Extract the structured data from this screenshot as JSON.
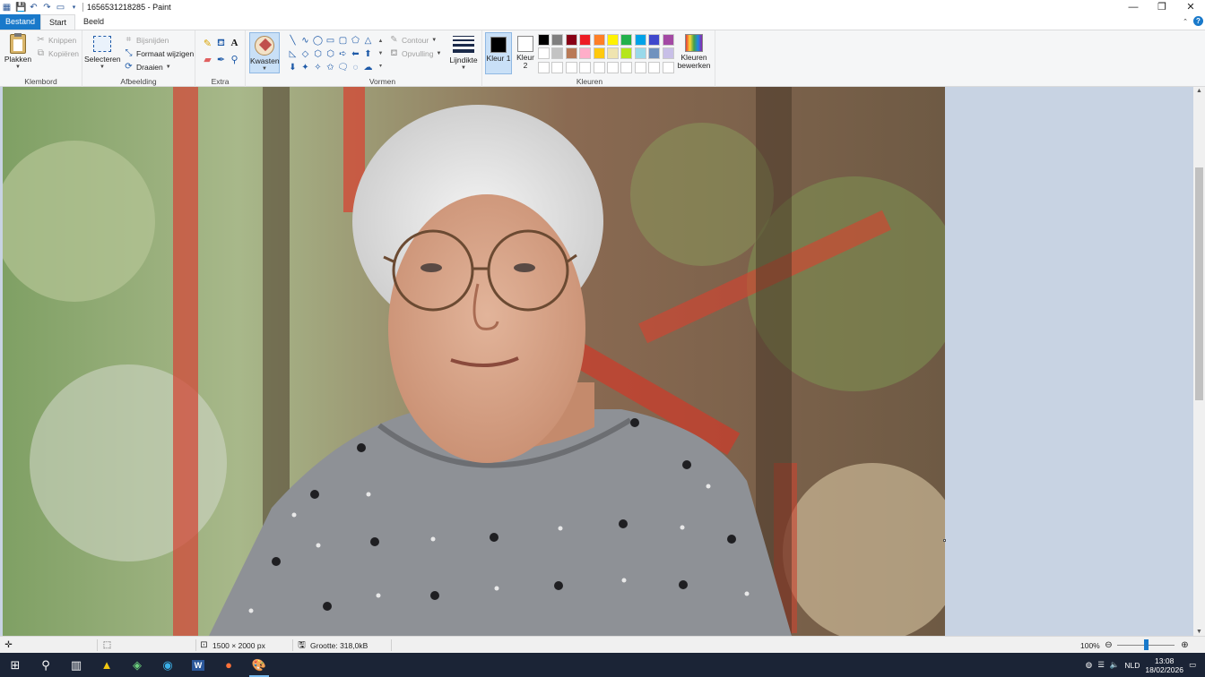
{
  "window": {
    "title": "1656531218285 - Paint",
    "controls": {
      "minimize": "—",
      "restore": "❐",
      "close": "✕"
    }
  },
  "quick_access": {
    "icons": [
      "paint-app-icon",
      "save-icon",
      "undo-icon",
      "redo-icon",
      "print-icon",
      "customize-dropdown-icon"
    ]
  },
  "tabs": [
    {
      "label": "Bestand"
    },
    {
      "label": "Start"
    },
    {
      "label": "Beeld"
    }
  ],
  "ribbon": {
    "klembord": {
      "label": "Klembord",
      "paste": "Plakken",
      "cut": "Knippen",
      "copy": "Kopiëren"
    },
    "afbeelding": {
      "label": "Afbeelding",
      "select": "Selecteren",
      "crop": "Bijsnijden",
      "resize": "Formaat wijzigen",
      "rotate": "Draaien"
    },
    "extra": {
      "label": "Extra"
    },
    "brushes": {
      "label": "Kwasten"
    },
    "vormen": {
      "label": "Vormen",
      "outline": "Contour",
      "fill": "Opvulling",
      "shapes": [
        "╲",
        "∿",
        "◯",
        "▭",
        "▢",
        "⬠",
        "△",
        "◺",
        "◇",
        "⬡",
        "⬡",
        "➪",
        "⬅",
        "⬆",
        "⬇",
        "✦",
        "✧",
        "✩",
        "🗨",
        "◌",
        "☁"
      ]
    },
    "line_width": {
      "label": "Lijndikte"
    },
    "color1": {
      "label": "Kleur 1",
      "color": "#000000"
    },
    "color2": {
      "label": "Kleur 2",
      "color": "#ffffff"
    },
    "kleuren": {
      "label": "Kleuren",
      "edit": "Kleuren bewerken",
      "palette": [
        "#000000",
        "#7f7f7f",
        "#880015",
        "#ed1c24",
        "#ff7f27",
        "#fff200",
        "#22b14c",
        "#00a2e8",
        "#3f48cc",
        "#a349a4",
        "#ffffff",
        "#c3c3c3",
        "#b97a57",
        "#ffaec9",
        "#ffc90e",
        "#efe4b0",
        "#b5e61d",
        "#99d9ea",
        "#7092be",
        "#c8bfe7",
        "#ffffff",
        "#ffffff",
        "#ffffff",
        "#ffffff",
        "#ffffff",
        "#ffffff",
        "#ffffff",
        "#ffffff",
        "#ffffff",
        "#ffffff"
      ]
    }
  },
  "status": {
    "dimensions": "1500 × 2000 px",
    "size": "Grootte: 318,0kB",
    "zoom": "100%",
    "zoom_level": 0.5
  },
  "taskbar": {
    "apps": [
      "windows-start-icon",
      "search-icon",
      "task-view-icon",
      "warning-app-icon",
      "green-app-icon",
      "edge-icon",
      "word-icon",
      "firefox-icon",
      "paint-icon"
    ],
    "language": "NLD",
    "time": "13:08",
    "date": "18/02/2026"
  }
}
